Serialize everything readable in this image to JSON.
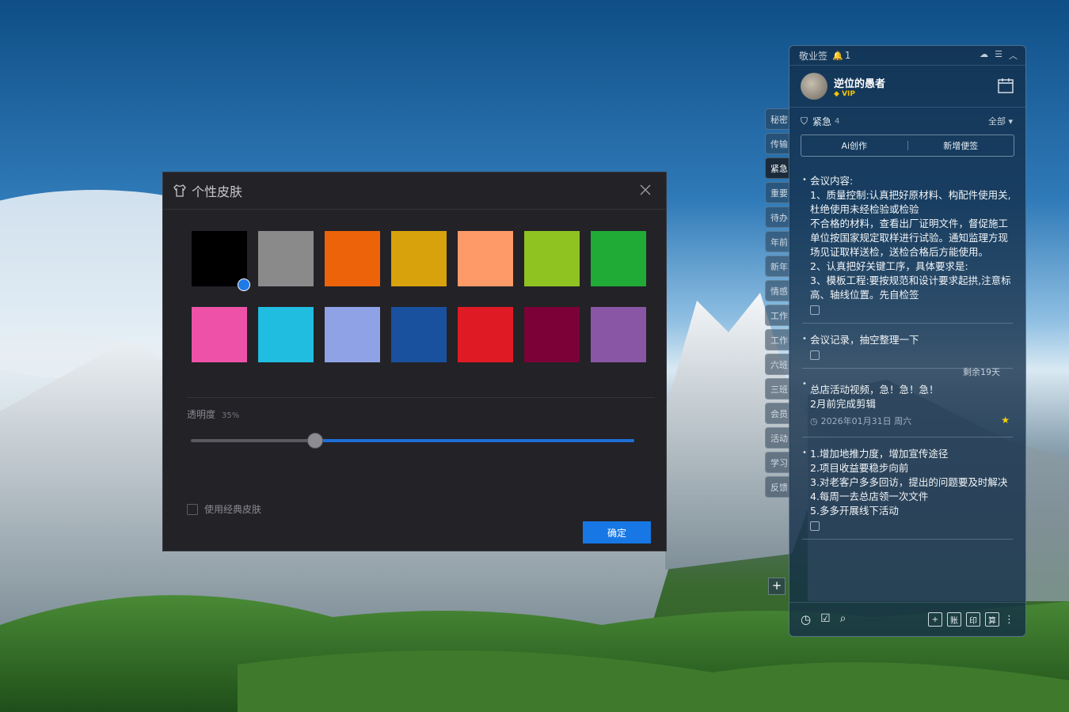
{
  "skin_dialog": {
    "title": "个性皮肤",
    "colors": [
      "#000000",
      "#8a8a8a",
      "#ec630a",
      "#d7a20b",
      "#fe9a68",
      "#8ec322",
      "#20ab37",
      "#ed52a8",
      "#20bde1",
      "#8fa2e5",
      "#1a519e",
      "#e01a25",
      "#7c0137",
      "#8856a4"
    ],
    "selected_index": 0,
    "opacity_label": "透明度",
    "opacity_value": "35%",
    "opacity_fraction": 0.28,
    "classic_skin_label": "使用经典皮肤",
    "confirm_label": "确定"
  },
  "side_tabs": [
    "秘密",
    "传输",
    "紧急",
    "重要",
    "待办",
    "年前",
    "新年",
    "情感",
    "工作",
    "工作",
    "六班",
    "三班",
    "会员",
    "活动",
    "学习",
    "反馈"
  ],
  "active_tab_index": 2,
  "panel": {
    "app_name": "敬业签",
    "reminder_count": "1",
    "user_name": "逆位的愚者",
    "vip_label": "VIP",
    "category": "紧急",
    "category_count": "4",
    "filter_label": "全部",
    "ai_button": "Ai创作",
    "new_note_button": "新增便签",
    "notes": [
      {
        "text": "会议内容:\n1、质量控制:认真把好原材料、构配件使用关,杜绝使用未经检验或检验\n不合格的材料，查看出厂证明文件，督促施工单位按国家规定取样进行试验。通知监理方现场见证取样送检，送检合格后方能使用。\n2、认真把好关键工序，具体要求是:\n3、模板工程:要按规范和设计要求起拱,注意标高、轴线位置。先自检签"
      },
      {
        "text": "会议记录，抽空整理一下"
      },
      {
        "text": "总店活动视频，急！急！急！\n2月前完成剪辑",
        "remaining": "剩余19天",
        "due": "2026年01月31日 周六"
      },
      {
        "text": "1.增加地推力度，增加宣传途径\n2.项目收益要稳步向前\n3.对老客户多多回访，提出的问题要及时解决\n4.每周一去总店领一次文件\n5.多多开展线下活动"
      }
    ],
    "bottom_labels": [
      "账",
      "印",
      "算"
    ]
  }
}
